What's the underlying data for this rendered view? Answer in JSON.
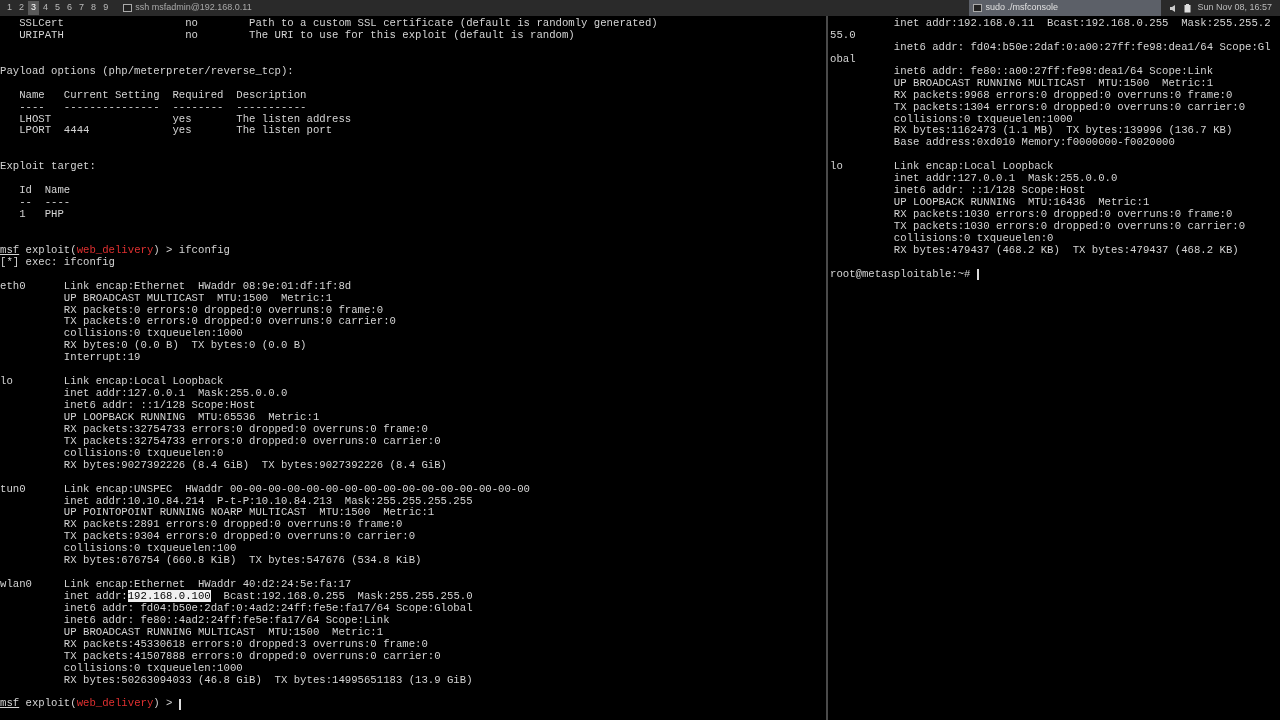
{
  "panel": {
    "workspaces": [
      {
        "label": "1",
        "selected": false
      },
      {
        "label": "2",
        "selected": false
      },
      {
        "label": "3",
        "selected": true
      },
      {
        "label": "4",
        "selected": false
      },
      {
        "label": "5",
        "selected": false
      },
      {
        "label": "6",
        "selected": false
      },
      {
        "label": "7",
        "selected": false
      },
      {
        "label": "8",
        "selected": false
      },
      {
        "label": "9",
        "selected": false
      }
    ],
    "tasks": [
      {
        "title": "ssh msfadmin@192.168.0.11",
        "selected": false
      },
      {
        "title": "sudo ./msfconsole",
        "selected": true
      }
    ],
    "clock": "Sun Nov 08, 16:57"
  },
  "left_terminal": {
    "lines": [
      {
        "kind": "text",
        "text": "   SSLCert                   no        Path to a custom SSL certificate (default is randomly generated)"
      },
      {
        "kind": "text",
        "text": "   URIPATH                   no        The URI to use for this exploit (default is random)"
      },
      {
        "kind": "blank"
      },
      {
        "kind": "blank"
      },
      {
        "kind": "text",
        "text": "Payload options (php/meterpreter/reverse_tcp):"
      },
      {
        "kind": "blank"
      },
      {
        "kind": "text",
        "text": "   Name   Current Setting  Required  Description"
      },
      {
        "kind": "text",
        "text": "   ----   ---------------  --------  -----------"
      },
      {
        "kind": "text",
        "text": "   LHOST                   yes       The listen address"
      },
      {
        "kind": "text",
        "text": "   LPORT  4444             yes       The listen port"
      },
      {
        "kind": "blank"
      },
      {
        "kind": "blank"
      },
      {
        "kind": "text",
        "text": "Exploit target:"
      },
      {
        "kind": "blank"
      },
      {
        "kind": "text",
        "text": "   Id  Name"
      },
      {
        "kind": "text",
        "text": "   --  ----"
      },
      {
        "kind": "text",
        "text": "   1   PHP"
      },
      {
        "kind": "blank"
      },
      {
        "kind": "blank"
      },
      {
        "kind": "segments",
        "cursor": false,
        "segments": [
          {
            "text": "msf",
            "kind": "prompt"
          },
          {
            "text": " exploit(",
            "kind": "text"
          },
          {
            "text": "web_delivery",
            "kind": "module"
          },
          {
            "text": ") > ifconfig",
            "kind": "text"
          }
        ]
      },
      {
        "kind": "text",
        "text": "[*] exec: ifconfig"
      },
      {
        "kind": "blank"
      },
      {
        "kind": "text",
        "text": "eth0      Link encap:Ethernet  HWaddr 08:9e:01:df:1f:8d"
      },
      {
        "kind": "text",
        "text": "          UP BROADCAST MULTICAST  MTU:1500  Metric:1"
      },
      {
        "kind": "text",
        "text": "          RX packets:0 errors:0 dropped:0 overruns:0 frame:0"
      },
      {
        "kind": "text",
        "text": "          TX packets:0 errors:0 dropped:0 overruns:0 carrier:0"
      },
      {
        "kind": "text",
        "text": "          collisions:0 txqueuelen:1000"
      },
      {
        "kind": "text",
        "text": "          RX bytes:0 (0.0 B)  TX bytes:0 (0.0 B)"
      },
      {
        "kind": "text",
        "text": "          Interrupt:19"
      },
      {
        "kind": "blank"
      },
      {
        "kind": "text",
        "text": "lo        Link encap:Local Loopback"
      },
      {
        "kind": "text",
        "text": "          inet addr:127.0.0.1  Mask:255.0.0.0"
      },
      {
        "kind": "text",
        "text": "          inet6 addr: ::1/128 Scope:Host"
      },
      {
        "kind": "text",
        "text": "          UP LOOPBACK RUNNING  MTU:65536  Metric:1"
      },
      {
        "kind": "text",
        "text": "          RX packets:32754733 errors:0 dropped:0 overruns:0 frame:0"
      },
      {
        "kind": "text",
        "text": "          TX packets:32754733 errors:0 dropped:0 overruns:0 carrier:0"
      },
      {
        "kind": "text",
        "text": "          collisions:0 txqueuelen:0"
      },
      {
        "kind": "text",
        "text": "          RX bytes:9027392226 (8.4 GiB)  TX bytes:9027392226 (8.4 GiB)"
      },
      {
        "kind": "blank"
      },
      {
        "kind": "text",
        "text": "tun0      Link encap:UNSPEC  HWaddr 00-00-00-00-00-00-00-00-00-00-00-00-00-00-00-00"
      },
      {
        "kind": "text",
        "text": "          inet addr:10.10.84.214  P-t-P:10.10.84.213  Mask:255.255.255.255"
      },
      {
        "kind": "text",
        "text": "          UP POINTOPOINT RUNNING NOARP MULTICAST  MTU:1500  Metric:1"
      },
      {
        "kind": "text",
        "text": "          RX packets:2891 errors:0 dropped:0 overruns:0 frame:0"
      },
      {
        "kind": "text",
        "text": "          TX packets:9304 errors:0 dropped:0 overruns:0 carrier:0"
      },
      {
        "kind": "text",
        "text": "          collisions:0 txqueuelen:100"
      },
      {
        "kind": "text",
        "text": "          RX bytes:676754 (660.8 KiB)  TX bytes:547676 (534.8 KiB)"
      },
      {
        "kind": "blank"
      },
      {
        "kind": "text",
        "text": "wlan0     Link encap:Ethernet  HWaddr 40:d2:24:5e:fa:17"
      },
      {
        "kind": "segments",
        "cursor": false,
        "segments": [
          {
            "text": "          inet addr:",
            "kind": "text"
          },
          {
            "text": "192.168.0.100",
            "kind": "selection"
          },
          {
            "text": "  Bcast:192.168.0.255  Mask:255.255.255.0",
            "kind": "text"
          }
        ]
      },
      {
        "kind": "text",
        "text": "          inet6 addr: fd04:b50e:2daf:0:4ad2:24ff:fe5e:fa17/64 Scope:Global"
      },
      {
        "kind": "text",
        "text": "          inet6 addr: fe80::4ad2:24ff:fe5e:fa17/64 Scope:Link"
      },
      {
        "kind": "text",
        "text": "          UP BROADCAST RUNNING MULTICAST  MTU:1500  Metric:1"
      },
      {
        "kind": "text",
        "text": "          RX packets:45330618 errors:0 dropped:3 overruns:0 frame:0"
      },
      {
        "kind": "text",
        "text": "          TX packets:41507888 errors:0 dropped:0 overruns:0 carrier:0"
      },
      {
        "kind": "text",
        "text": "          collisions:0 txqueuelen:1000"
      },
      {
        "kind": "text",
        "text": "          RX bytes:50263094033 (46.8 GiB)  TX bytes:14995651183 (13.9 GiB)"
      },
      {
        "kind": "blank"
      },
      {
        "kind": "segments",
        "cursor": true,
        "segments": [
          {
            "text": "msf",
            "kind": "prompt"
          },
          {
            "text": " exploit(",
            "kind": "text"
          },
          {
            "text": "web_delivery",
            "kind": "module"
          },
          {
            "text": ") > ",
            "kind": "text"
          }
        ]
      }
    ]
  },
  "right_terminal": {
    "lines": [
      {
        "kind": "text",
        "text": "          inet addr:192.168.0.11  Bcast:192.168.0.255  Mask:255.255.2"
      },
      {
        "kind": "text",
        "text": "55.0"
      },
      {
        "kind": "text",
        "text": "          inet6 addr: fd04:b50e:2daf:0:a00:27ff:fe98:dea1/64 Scope:Gl"
      },
      {
        "kind": "text",
        "text": "obal"
      },
      {
        "kind": "text",
        "text": "          inet6 addr: fe80::a00:27ff:fe98:dea1/64 Scope:Link"
      },
      {
        "kind": "text",
        "text": "          UP BROADCAST RUNNING MULTICAST  MTU:1500  Metric:1"
      },
      {
        "kind": "text",
        "text": "          RX packets:9968 errors:0 dropped:0 overruns:0 frame:0"
      },
      {
        "kind": "text",
        "text": "          TX packets:1304 errors:0 dropped:0 overruns:0 carrier:0"
      },
      {
        "kind": "text",
        "text": "          collisions:0 txqueuelen:1000"
      },
      {
        "kind": "text",
        "text": "          RX bytes:1162473 (1.1 MB)  TX bytes:139996 (136.7 KB)"
      },
      {
        "kind": "text",
        "text": "          Base address:0xd010 Memory:f0000000-f0020000"
      },
      {
        "kind": "blank"
      },
      {
        "kind": "text",
        "text": "lo        Link encap:Local Loopback"
      },
      {
        "kind": "text",
        "text": "          inet addr:127.0.0.1  Mask:255.0.0.0"
      },
      {
        "kind": "text",
        "text": "          inet6 addr: ::1/128 Scope:Host"
      },
      {
        "kind": "text",
        "text": "          UP LOOPBACK RUNNING  MTU:16436  Metric:1"
      },
      {
        "kind": "text",
        "text": "          RX packets:1030 errors:0 dropped:0 overruns:0 frame:0"
      },
      {
        "kind": "text",
        "text": "          TX packets:1030 errors:0 dropped:0 overruns:0 carrier:0"
      },
      {
        "kind": "text",
        "text": "          collisions:0 txqueuelen:0"
      },
      {
        "kind": "text",
        "text": "          RX bytes:479437 (468.2 KB)  TX bytes:479437 (468.2 KB)"
      },
      {
        "kind": "blank"
      },
      {
        "kind": "segments",
        "cursor": true,
        "segments": [
          {
            "text": "root@metasploitable:~# ",
            "kind": "text"
          }
        ]
      }
    ]
  }
}
